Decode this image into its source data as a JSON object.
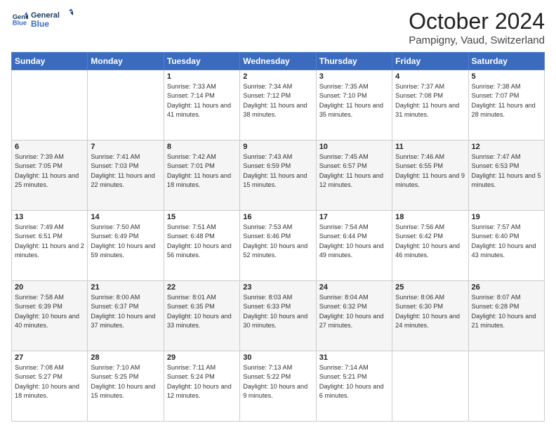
{
  "header": {
    "logo_line1": "General",
    "logo_line2": "Blue",
    "month": "October 2024",
    "location": "Pampigny, Vaud, Switzerland"
  },
  "weekdays": [
    "Sunday",
    "Monday",
    "Tuesday",
    "Wednesday",
    "Thursday",
    "Friday",
    "Saturday"
  ],
  "weeks": [
    [
      {
        "day": "",
        "sunrise": "",
        "sunset": "",
        "daylight": ""
      },
      {
        "day": "",
        "sunrise": "",
        "sunset": "",
        "daylight": ""
      },
      {
        "day": "1",
        "sunrise": "Sunrise: 7:33 AM",
        "sunset": "Sunset: 7:14 PM",
        "daylight": "Daylight: 11 hours and 41 minutes."
      },
      {
        "day": "2",
        "sunrise": "Sunrise: 7:34 AM",
        "sunset": "Sunset: 7:12 PM",
        "daylight": "Daylight: 11 hours and 38 minutes."
      },
      {
        "day": "3",
        "sunrise": "Sunrise: 7:35 AM",
        "sunset": "Sunset: 7:10 PM",
        "daylight": "Daylight: 11 hours and 35 minutes."
      },
      {
        "day": "4",
        "sunrise": "Sunrise: 7:37 AM",
        "sunset": "Sunset: 7:08 PM",
        "daylight": "Daylight: 11 hours and 31 minutes."
      },
      {
        "day": "5",
        "sunrise": "Sunrise: 7:38 AM",
        "sunset": "Sunset: 7:07 PM",
        "daylight": "Daylight: 11 hours and 28 minutes."
      }
    ],
    [
      {
        "day": "6",
        "sunrise": "Sunrise: 7:39 AM",
        "sunset": "Sunset: 7:05 PM",
        "daylight": "Daylight: 11 hours and 25 minutes."
      },
      {
        "day": "7",
        "sunrise": "Sunrise: 7:41 AM",
        "sunset": "Sunset: 7:03 PM",
        "daylight": "Daylight: 11 hours and 22 minutes."
      },
      {
        "day": "8",
        "sunrise": "Sunrise: 7:42 AM",
        "sunset": "Sunset: 7:01 PM",
        "daylight": "Daylight: 11 hours and 18 minutes."
      },
      {
        "day": "9",
        "sunrise": "Sunrise: 7:43 AM",
        "sunset": "Sunset: 6:59 PM",
        "daylight": "Daylight: 11 hours and 15 minutes."
      },
      {
        "day": "10",
        "sunrise": "Sunrise: 7:45 AM",
        "sunset": "Sunset: 6:57 PM",
        "daylight": "Daylight: 11 hours and 12 minutes."
      },
      {
        "day": "11",
        "sunrise": "Sunrise: 7:46 AM",
        "sunset": "Sunset: 6:55 PM",
        "daylight": "Daylight: 11 hours and 9 minutes."
      },
      {
        "day": "12",
        "sunrise": "Sunrise: 7:47 AM",
        "sunset": "Sunset: 6:53 PM",
        "daylight": "Daylight: 11 hours and 5 minutes."
      }
    ],
    [
      {
        "day": "13",
        "sunrise": "Sunrise: 7:49 AM",
        "sunset": "Sunset: 6:51 PM",
        "daylight": "Daylight: 11 hours and 2 minutes."
      },
      {
        "day": "14",
        "sunrise": "Sunrise: 7:50 AM",
        "sunset": "Sunset: 6:49 PM",
        "daylight": "Daylight: 10 hours and 59 minutes."
      },
      {
        "day": "15",
        "sunrise": "Sunrise: 7:51 AM",
        "sunset": "Sunset: 6:48 PM",
        "daylight": "Daylight: 10 hours and 56 minutes."
      },
      {
        "day": "16",
        "sunrise": "Sunrise: 7:53 AM",
        "sunset": "Sunset: 6:46 PM",
        "daylight": "Daylight: 10 hours and 52 minutes."
      },
      {
        "day": "17",
        "sunrise": "Sunrise: 7:54 AM",
        "sunset": "Sunset: 6:44 PM",
        "daylight": "Daylight: 10 hours and 49 minutes."
      },
      {
        "day": "18",
        "sunrise": "Sunrise: 7:56 AM",
        "sunset": "Sunset: 6:42 PM",
        "daylight": "Daylight: 10 hours and 46 minutes."
      },
      {
        "day": "19",
        "sunrise": "Sunrise: 7:57 AM",
        "sunset": "Sunset: 6:40 PM",
        "daylight": "Daylight: 10 hours and 43 minutes."
      }
    ],
    [
      {
        "day": "20",
        "sunrise": "Sunrise: 7:58 AM",
        "sunset": "Sunset: 6:39 PM",
        "daylight": "Daylight: 10 hours and 40 minutes."
      },
      {
        "day": "21",
        "sunrise": "Sunrise: 8:00 AM",
        "sunset": "Sunset: 6:37 PM",
        "daylight": "Daylight: 10 hours and 37 minutes."
      },
      {
        "day": "22",
        "sunrise": "Sunrise: 8:01 AM",
        "sunset": "Sunset: 6:35 PM",
        "daylight": "Daylight: 10 hours and 33 minutes."
      },
      {
        "day": "23",
        "sunrise": "Sunrise: 8:03 AM",
        "sunset": "Sunset: 6:33 PM",
        "daylight": "Daylight: 10 hours and 30 minutes."
      },
      {
        "day": "24",
        "sunrise": "Sunrise: 8:04 AM",
        "sunset": "Sunset: 6:32 PM",
        "daylight": "Daylight: 10 hours and 27 minutes."
      },
      {
        "day": "25",
        "sunrise": "Sunrise: 8:06 AM",
        "sunset": "Sunset: 6:30 PM",
        "daylight": "Daylight: 10 hours and 24 minutes."
      },
      {
        "day": "26",
        "sunrise": "Sunrise: 8:07 AM",
        "sunset": "Sunset: 6:28 PM",
        "daylight": "Daylight: 10 hours and 21 minutes."
      }
    ],
    [
      {
        "day": "27",
        "sunrise": "Sunrise: 7:08 AM",
        "sunset": "Sunset: 5:27 PM",
        "daylight": "Daylight: 10 hours and 18 minutes."
      },
      {
        "day": "28",
        "sunrise": "Sunrise: 7:10 AM",
        "sunset": "Sunset: 5:25 PM",
        "daylight": "Daylight: 10 hours and 15 minutes."
      },
      {
        "day": "29",
        "sunrise": "Sunrise: 7:11 AM",
        "sunset": "Sunset: 5:24 PM",
        "daylight": "Daylight: 10 hours and 12 minutes."
      },
      {
        "day": "30",
        "sunrise": "Sunrise: 7:13 AM",
        "sunset": "Sunset: 5:22 PM",
        "daylight": "Daylight: 10 hours and 9 minutes."
      },
      {
        "day": "31",
        "sunrise": "Sunrise: 7:14 AM",
        "sunset": "Sunset: 5:21 PM",
        "daylight": "Daylight: 10 hours and 6 minutes."
      },
      {
        "day": "",
        "sunrise": "",
        "sunset": "",
        "daylight": ""
      },
      {
        "day": "",
        "sunrise": "",
        "sunset": "",
        "daylight": ""
      }
    ]
  ]
}
